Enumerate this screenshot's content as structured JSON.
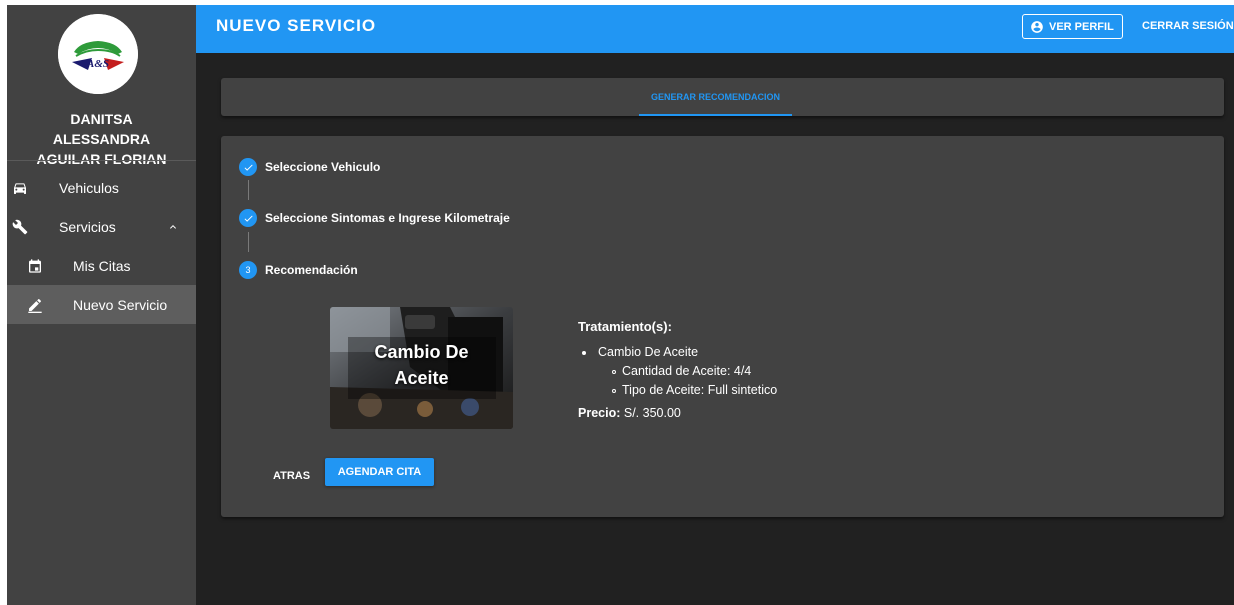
{
  "colors": {
    "primary": "#2196f3",
    "sidebar": "#424242",
    "panel": "#424242",
    "background": "#212121"
  },
  "logo": {
    "text": "A&S"
  },
  "sidebar": {
    "user_name": "DANITSA ALESSANDRA AGUILAR FLORIAN",
    "items": [
      {
        "label": "Vehiculos",
        "icon": "car-icon"
      },
      {
        "label": "Servicios",
        "icon": "wrench-icon",
        "expanded": true
      },
      {
        "label": "Mis Citas",
        "icon": "calendar-icon"
      },
      {
        "label": "Nuevo Servicio",
        "icon": "pencil-icon",
        "active": true
      }
    ]
  },
  "header": {
    "title": "NUEVO SERVICIO",
    "profile_label": "VER PERFIL",
    "logout_label": "CERRAR SESIÓN"
  },
  "tabs": [
    {
      "label": "GENERAR RECOMENDACION",
      "active": true
    }
  ],
  "stepper": {
    "steps": [
      {
        "label": "Seleccione Vehiculo",
        "done": true,
        "number": "1"
      },
      {
        "label": "Seleccione Sintomas e Ingrese Kilometraje",
        "done": true,
        "number": "2"
      },
      {
        "label": "Recomendación",
        "done": false,
        "number": "3"
      }
    ]
  },
  "recommendation": {
    "card_title": "Cambio De Aceite",
    "treatment_heading": "Tratamiento(s):",
    "treatment_name": "Cambio De Aceite",
    "details": [
      "Cantidad de Aceite: 4/4",
      "Tipo de Aceite: Full sintetico"
    ],
    "price_label": "Precio:",
    "price_value": "S/. 350.00"
  },
  "actions": {
    "back_label": "ATRAS",
    "schedule_label": "AGENDAR CITA"
  }
}
